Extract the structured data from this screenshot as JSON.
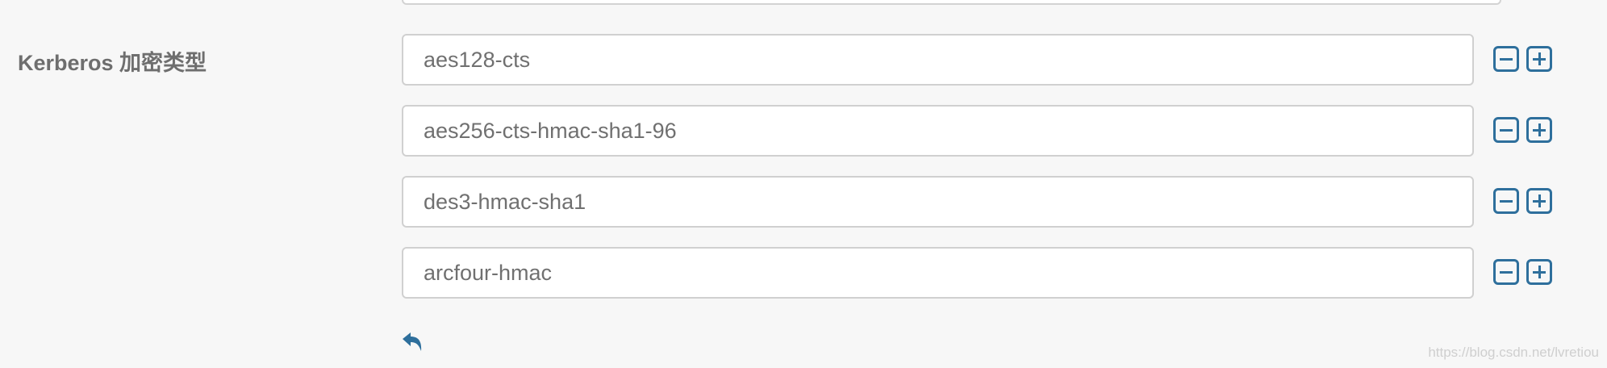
{
  "field": {
    "label": "Kerberos 加密类型",
    "values": [
      "aes128-cts",
      "aes256-cts-hmac-sha1-96",
      "des3-hmac-sha1",
      "arcfour-hmac"
    ]
  },
  "icons": {
    "remove": "minus-square-icon",
    "add": "plus-square-icon",
    "undo": "undo-arrow-icon"
  },
  "colors": {
    "accent": "#2e6f9c",
    "background": "#f7f7f7",
    "label": "#6e6e6e",
    "input_text": "#707070"
  },
  "watermark": "https://blog.csdn.net/lvretiou"
}
